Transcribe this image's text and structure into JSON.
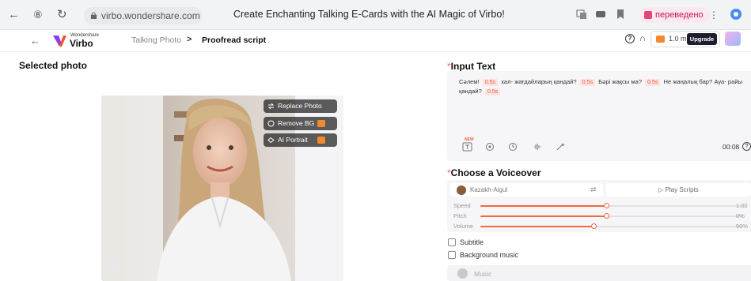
{
  "browser": {
    "url": "virbo.wondershare.com",
    "page_title": "Create Enchanting Talking E-Cards with the AI Magic of Virbo!",
    "translated_label": "переведено"
  },
  "app": {
    "brand_small": "Wondershare",
    "brand_big": "Virbo",
    "breadcrumb": [
      "Talking Photo",
      "Proofread script"
    ],
    "duration": "1.0 min",
    "upgrade_label": "Upgrade"
  },
  "photo_panel": {
    "title": "Selected photo",
    "actions": [
      "Replace Photo",
      "Remove BG",
      "AI Portrait"
    ]
  },
  "input_text": {
    "title": "Input Text",
    "pause_label": "0.5s",
    "segments": [
      "Сәлем!",
      "хал- жағдайларың қандай?",
      "Бәрі жақсы ма?",
      "Не жаңалық бар? Ауа- райы қандай?"
    ],
    "new_badge": "NEW",
    "time": "00:08"
  },
  "voiceover": {
    "title": "Choose a Voiceover",
    "voice_name": "Kazakh-Aigul",
    "play_label": "▷ Play Scripts",
    "sliders": [
      {
        "label": "Speed",
        "value": "1.00",
        "fraction": 0.48
      },
      {
        "label": "Pitch",
        "value": "0%",
        "fraction": 0.48
      },
      {
        "label": "Volume",
        "value": "50%",
        "fraction": 0.43
      }
    ]
  },
  "options": {
    "subtitle_label": "Subtitle",
    "music_label": "Background music",
    "music_placeholder": "Music"
  },
  "colors": {
    "accent": "#f06a3c",
    "pause_bg": "#fde3df",
    "upgrade_bg": "#1d1d2f"
  }
}
